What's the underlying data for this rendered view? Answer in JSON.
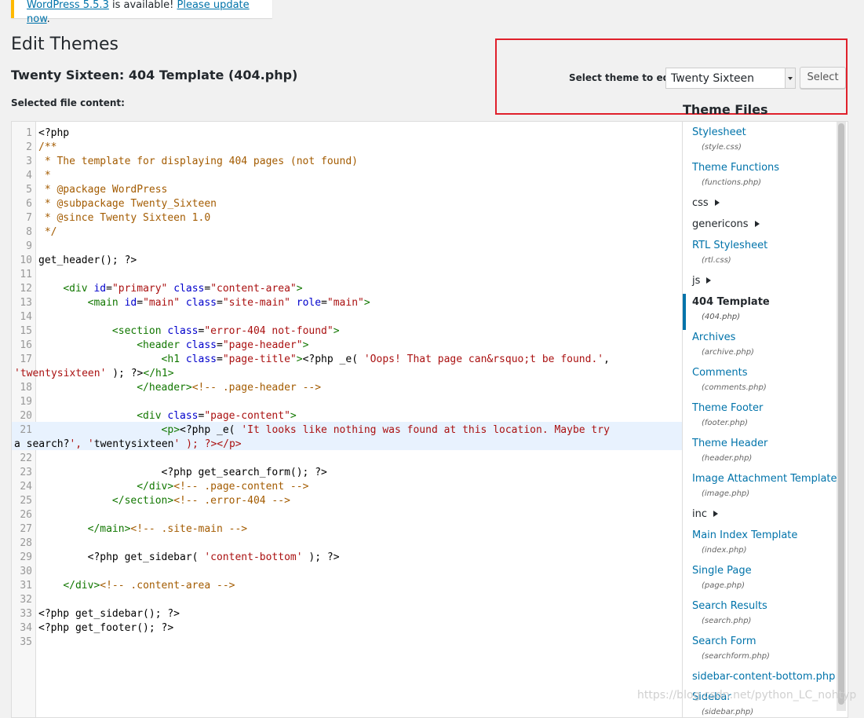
{
  "notice": {
    "link1": "WordPress 5.5.3",
    "middle": " is available! ",
    "link2": "Please update now",
    "end": "."
  },
  "page_title": "Edit Themes",
  "file_title": "Twenty Sixteen: 404 Template (404.php)",
  "selected_file_label": "Selected file content:",
  "theme_select": {
    "label": "Select theme to edit:",
    "value": "Twenty Sixteen",
    "button": "Select"
  },
  "theme_files": {
    "heading": "Theme Files",
    "items": [
      {
        "type": "file",
        "label": "Stylesheet",
        "file": "(style.css)"
      },
      {
        "type": "file",
        "label": "Theme Functions",
        "file": "(functions.php)"
      },
      {
        "type": "folder",
        "label": "css"
      },
      {
        "type": "folder",
        "label": "genericons"
      },
      {
        "type": "file",
        "label": "RTL Stylesheet",
        "file": "(rtl.css)"
      },
      {
        "type": "folder",
        "label": "js"
      },
      {
        "type": "file",
        "label": "404 Template",
        "file": "(404.php)",
        "active": true
      },
      {
        "type": "file",
        "label": "Archives",
        "file": "(archive.php)"
      },
      {
        "type": "file",
        "label": "Comments",
        "file": "(comments.php)"
      },
      {
        "type": "file",
        "label": "Theme Footer",
        "file": "(footer.php)"
      },
      {
        "type": "file",
        "label": "Theme Header",
        "file": "(header.php)"
      },
      {
        "type": "file",
        "label": "Image Attachment Template",
        "file": "(image.php)"
      },
      {
        "type": "folder",
        "label": "inc"
      },
      {
        "type": "file",
        "label": "Main Index Template",
        "file": "(index.php)"
      },
      {
        "type": "file",
        "label": "Single Page",
        "file": "(page.php)"
      },
      {
        "type": "file",
        "label": "Search Results",
        "file": "(search.php)"
      },
      {
        "type": "file",
        "label": "Search Form",
        "file": "(searchform.php)"
      },
      {
        "type": "file",
        "label": "sidebar-content-bottom.php",
        "file": ""
      },
      {
        "type": "file",
        "label": "Sidebar",
        "file": "(sidebar.php)"
      }
    ]
  },
  "code_lines": [
    "<?php",
    "/**",
    " * The template for displaying 404 pages (not found)",
    " *",
    " * @package WordPress",
    " * @subpackage Twenty_Sixteen",
    " * @since Twenty Sixteen 1.0",
    " */",
    "",
    "get_header(); ?>",
    "",
    "    <div id=\"primary\" class=\"content-area\">",
    "        <main id=\"main\" class=\"site-main\" role=\"main\">",
    "",
    "            <section class=\"error-404 not-found\">",
    "                <header class=\"page-header\">",
    "                    <h1 class=\"page-title\"><?php _e( 'Oops! That page can&rsquo;t be found.', 'twentysixteen' ); ?></h1>",
    "                </header><!-- .page-header -->",
    "",
    "                <div class=\"page-content\">",
    "                    <p><?php _e( 'It looks like nothing was found at this location. Maybe try a search?', 'twentysixteen' ); ?></p>",
    "",
    "                    <?php get_search_form(); ?>",
    "                </div><!-- .page-content -->",
    "            </section><!-- .error-404 -->",
    "",
    "        </main><!-- .site-main -->",
    "",
    "        <?php get_sidebar( 'content-bottom' ); ?>",
    "",
    "    </div><!-- .content-area -->",
    "",
    "<?php get_sidebar(); ?>",
    "<?php get_footer(); ?>",
    ""
  ],
  "highlighted_line": 21,
  "watermark": "https://blog.csdn.net/python_LC_nohtyp"
}
